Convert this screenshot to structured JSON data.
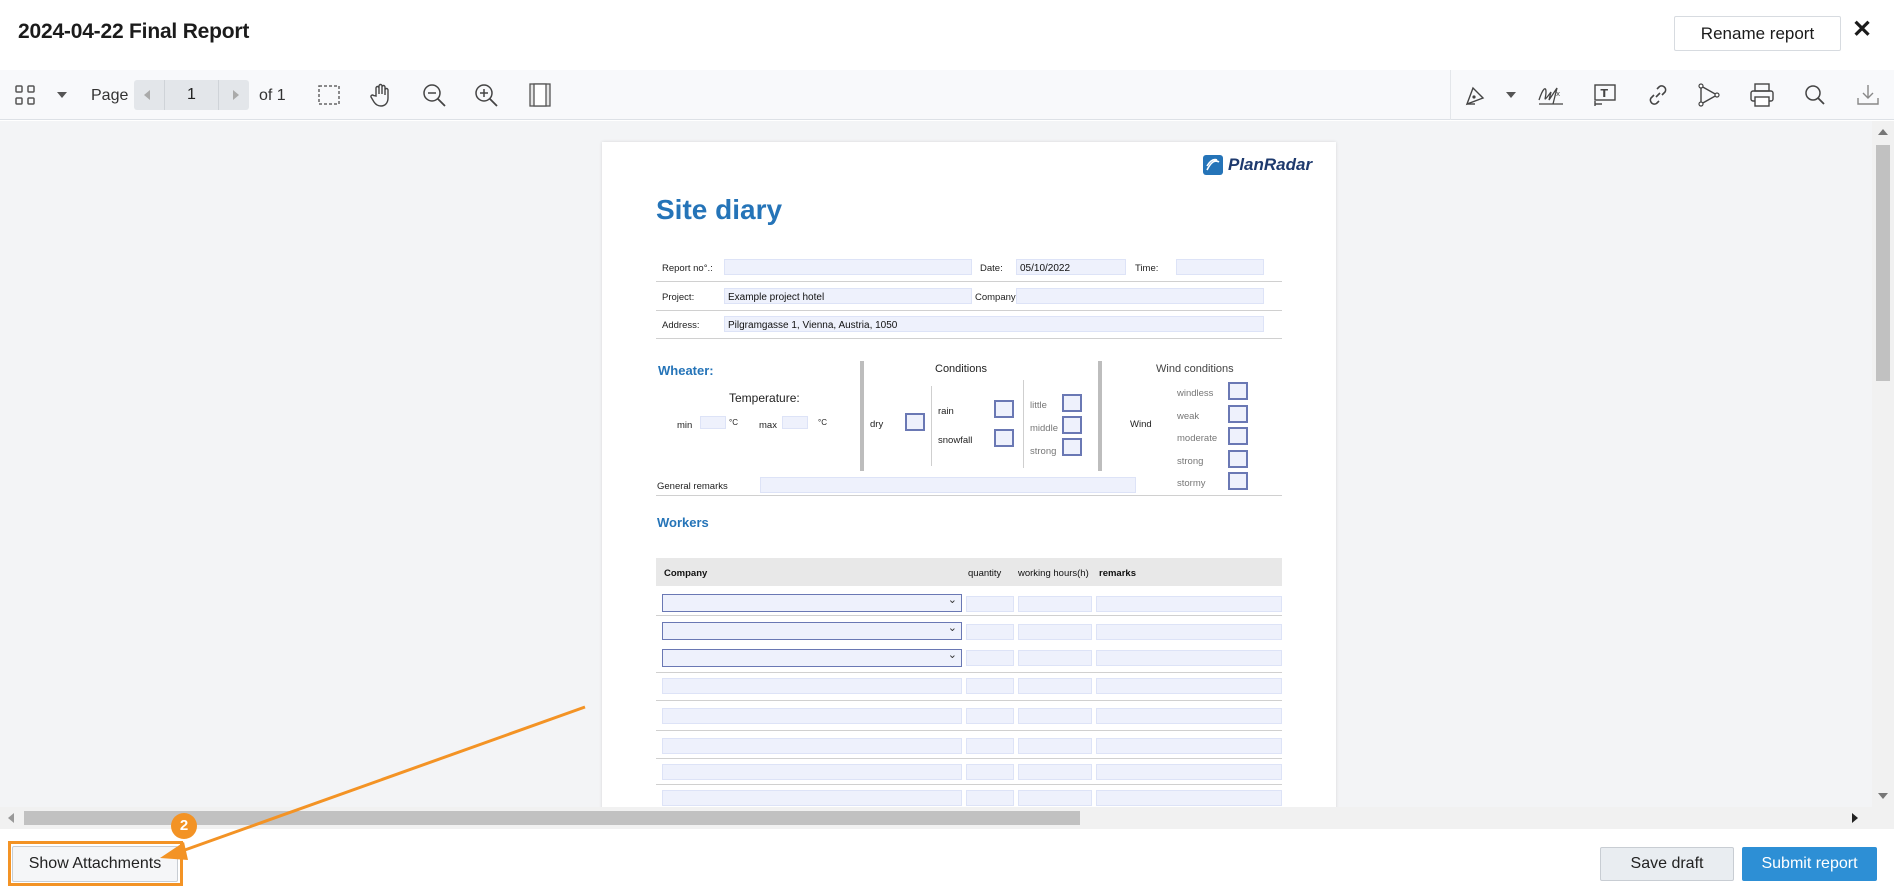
{
  "header": {
    "title": "2024-04-22 Final Report",
    "rename_label": "Rename report",
    "close_label": "✕"
  },
  "toolbar": {
    "page_label": "Page",
    "page_current": "1",
    "page_total_label": "of 1",
    "left_tools": [
      "thumbnails-icon",
      "dropdown-caret-icon",
      "marquee-select-icon",
      "pan-hand-icon",
      "zoom-out-icon",
      "zoom-in-icon",
      "single-page-view-icon"
    ],
    "right_tools": [
      "annotate-pen-icon",
      "dropdown-caret-icon",
      "signature-icon",
      "text-field-icon",
      "link-icon",
      "stamp-icon",
      "print-icon",
      "search-icon",
      "download-icon"
    ]
  },
  "document": {
    "logo_text": "PlanRadar",
    "title": "Site diary",
    "report_no_label": "Report no°.:",
    "date_label": "Date:",
    "date_value": "05/10/2022",
    "time_label": "Time:",
    "project_label": "Project:",
    "project_value": "Example project hotel",
    "company_label": "Company:",
    "address_label": "Address:",
    "address_value": "Pilgramgasse 1, Vienna, Austria, 1050",
    "weather_title": "Wheater:",
    "temperature_label": "Temperature:",
    "min_label": "min",
    "max_label": "max",
    "deg_unit": "°C",
    "conditions_title": "Conditions",
    "dry_label": "dry",
    "rain_label": "rain",
    "snowfall_label": "snowfall",
    "little_label": "little",
    "middle_label": "middle",
    "strong_label": "strong",
    "wind_conditions_title": "Wind conditions",
    "wind_label": "Wind",
    "windless_label": "windless",
    "weak_label": "weak",
    "moderate_label": "moderate",
    "wind_strong_label": "strong",
    "stormy_label": "stormy",
    "general_remarks_label": "General remarks",
    "workers_title": "Workers",
    "workers_headers": [
      "Company",
      "quantity",
      "working hours(h)",
      "remarks"
    ]
  },
  "footer": {
    "show_attachments_label": "Show Attachments",
    "step_badge": "2",
    "save_draft_label": "Save draft",
    "submit_label": "Submit report"
  },
  "colors": {
    "accent": "#2d8fd5",
    "highlight": "#f39325",
    "doc_blue": "#2574b8"
  }
}
